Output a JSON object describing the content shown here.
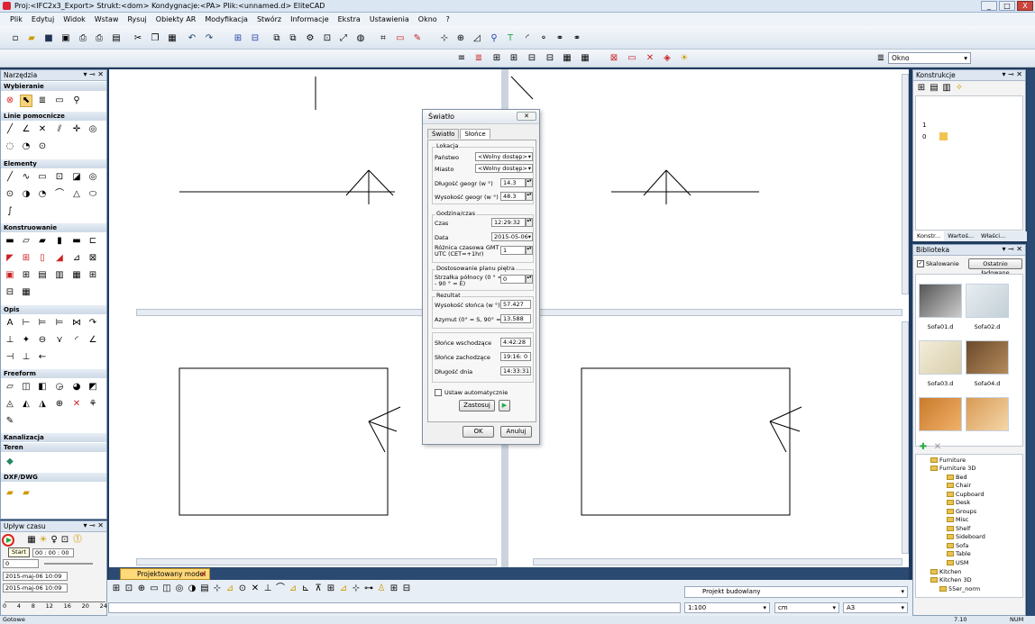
{
  "window": {
    "title": "Proj:<IFC2x3_Export> Strukt:<dom> Kondygnacje:<PA> Plik:<unnamed.d> EliteCAD",
    "controls": [
      "_",
      "□",
      "X"
    ]
  },
  "menu": {
    "items": [
      "Plik",
      "Edytuj",
      "Widok",
      "Wstaw",
      "Rysuj",
      "Obiekty AR",
      "Modyfikacja",
      "Stwórz",
      "Informacje",
      "Ekstra",
      "Ustawienia",
      "Okno",
      "?"
    ]
  },
  "toolbar2": {
    "window_select": "Okno"
  },
  "tools_panel": {
    "title": "Narzędzia",
    "sections": [
      "Wybieranie",
      "Linie pomocnicze",
      "Elementy",
      "Konstruowanie",
      "Opis",
      "Freeform",
      "Kanalizacja",
      "Teren",
      "DXF/DWG"
    ]
  },
  "time_panel": {
    "title": "Upływ czasu",
    "time_value": "00 : 00 : 00",
    "step_value": "0",
    "tooltip": "Start",
    "date1": "2015-maj-06 10:09",
    "date2": "2015-maj-06 10:09",
    "ticks": [
      "0",
      "4",
      "8",
      "12",
      "16",
      "20",
      "24"
    ]
  },
  "dialog": {
    "title": "Światło",
    "tabs": [
      "Światło",
      "Słońce"
    ],
    "active_tab": "Słońce",
    "groups": {
      "location": "Lokacja",
      "datetime": "Godzina/czas",
      "plan": "Dostosowanie planu piętra",
      "result": "Rezultat"
    },
    "fields": {
      "country_label": "Państwo",
      "country_value": "<Wolny dostęp>",
      "city_label": "Miasto",
      "city_value": "<Wolny dostęp>",
      "lon_label": "Długość geogr (w °)",
      "lon_value": "14.3",
      "lat_label": "Wysokość geogr (w °)",
      "lat_value": "48.3",
      "time_label": "Czas",
      "time_value": "12:29:32",
      "date_label": "Data",
      "date_value": "2015-05-06",
      "tz_label_1": "Różnica czasowa GMT",
      "tz_label_2": "UTC (CET=+1hr)",
      "tz_value": "1",
      "north_label_1": "Strzałka północy (0 ° = N 0",
      "north_label_2": "- 90 ° = E)",
      "north_value": "0",
      "sun_alt_label": "Wysokość słońca (w °)",
      "sun_alt_value": "57.427",
      "azimuth_label": "Azymut (0° = S, 90° = W)",
      "azimuth_value": "13.588",
      "sunrise_label": "Słońce wschodzące",
      "sunrise_value": "4:42:28",
      "sunset_label": "Słońce zachodzące",
      "sunset_value": "19:16: 0",
      "daylen_label": "Długość dnia",
      "daylen_value": "14:33:31"
    },
    "auto_label": "Ustaw automatycznie",
    "apply_label": "Zastosuj",
    "ok_label": "OK",
    "cancel_label": "Anuluj"
  },
  "doc_tab": {
    "label": "Projektowany model"
  },
  "status": {
    "project": "Projekt budowlany",
    "scale": "1:100",
    "unit": "cm",
    "paper": "A3",
    "ready": "Gotowe",
    "coord": "7.10",
    "num": "NUM"
  },
  "right_panels": {
    "construction_title": "Konstrukcje",
    "floors": [
      "1",
      "0"
    ],
    "tabs": [
      "Konstr...",
      "Wartoś...",
      "Właści..."
    ],
    "library_title": "Biblioteka",
    "scaling_label": "Skalowanie",
    "recent_label": "Ostatnio ładowane",
    "items": [
      "Sofa01.d",
      "Sofa02.d",
      "Sofa03.d",
      "Sofa04.d"
    ],
    "tree": [
      "Furniture",
      "Furniture 3D",
      "Bed",
      "Chair",
      "Cupboard",
      "Desk",
      "Groups",
      "Misc",
      "Shelf",
      "Sideboard",
      "Sofa",
      "Table",
      "USM",
      "Kitchen",
      "Kitchen 3D",
      "55er_norm"
    ]
  }
}
